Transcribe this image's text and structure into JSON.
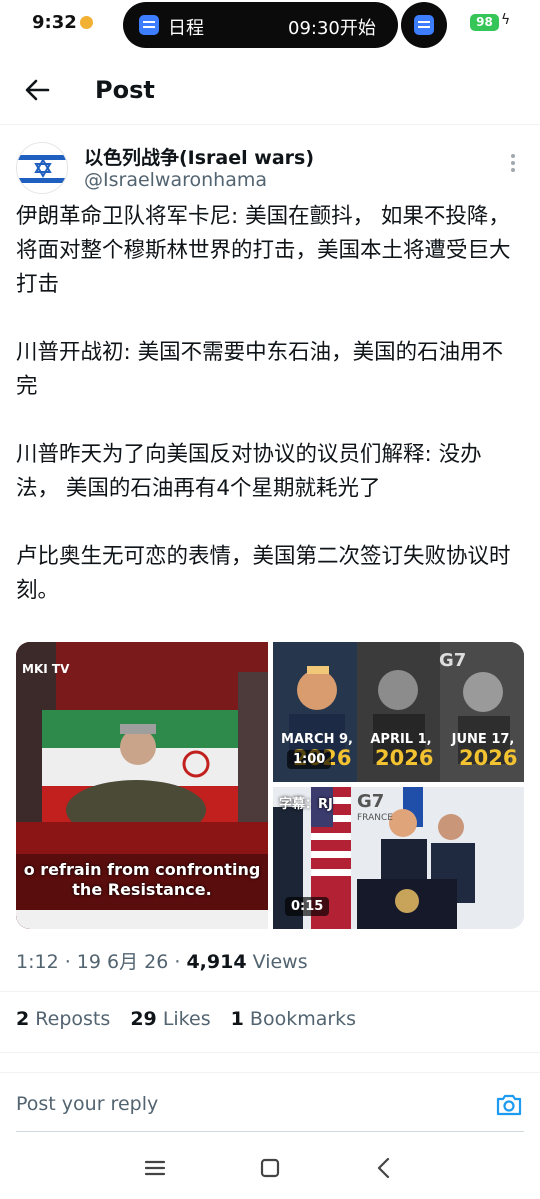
{
  "status": {
    "time": "9:32",
    "schedule_label": "日程",
    "schedule_time": "09:30开始",
    "battery": "98"
  },
  "header": {
    "title": "Post"
  },
  "author": {
    "name": "以色列战争(Israel wars)",
    "handle": "@Israelwaronhama"
  },
  "post": {
    "paragraphs": [
      "伊朗革命卫队将军卡尼: 美国在颤抖， 如果不投降，将面对整个穆斯林世界的打击，美国本土将遭受巨大打击",
      "川普开战初: 美国不需要中东石油，美国的石油用不完",
      "川普昨天为了向美国反对协议的议员们解释: 没办法， 美国的石油再有4个星期就耗光了",
      "卢比奥生无可恋的表情，美国第二次签订失败协议时刻。"
    ]
  },
  "media": {
    "left": {
      "caption_line1": "o refrain from confronting",
      "caption_line2": "the Resistance.",
      "channel": "MKI TV"
    },
    "top_right": {
      "dates": [
        {
          "date": "MARCH 9,",
          "year": "2026"
        },
        {
          "date": "APRIL 1,",
          "year": "2026"
        },
        {
          "date": "JUNE 17,",
          "year": "2026"
        }
      ],
      "duration": "1:00",
      "badge": "G7"
    },
    "bottom_right": {
      "subtitle_tag": "字幕：RJ",
      "duration": "0:15",
      "badge": "G7",
      "badge_sub": "FRANCE"
    }
  },
  "meta": {
    "time": "1:12",
    "date": "19 6月 26",
    "views": "4,914",
    "views_label": "Views"
  },
  "stats": {
    "reposts": "2",
    "reposts_label": "Reposts",
    "likes": "29",
    "likes_label": "Likes",
    "bookmarks": "1",
    "bookmarks_label": "Bookmarks"
  },
  "reply": {
    "placeholder": "Post your reply"
  },
  "colors": {
    "accent": "#1d9bf0",
    "text": "#0f1419",
    "secondary": "#536471",
    "battery": "#35c657"
  }
}
